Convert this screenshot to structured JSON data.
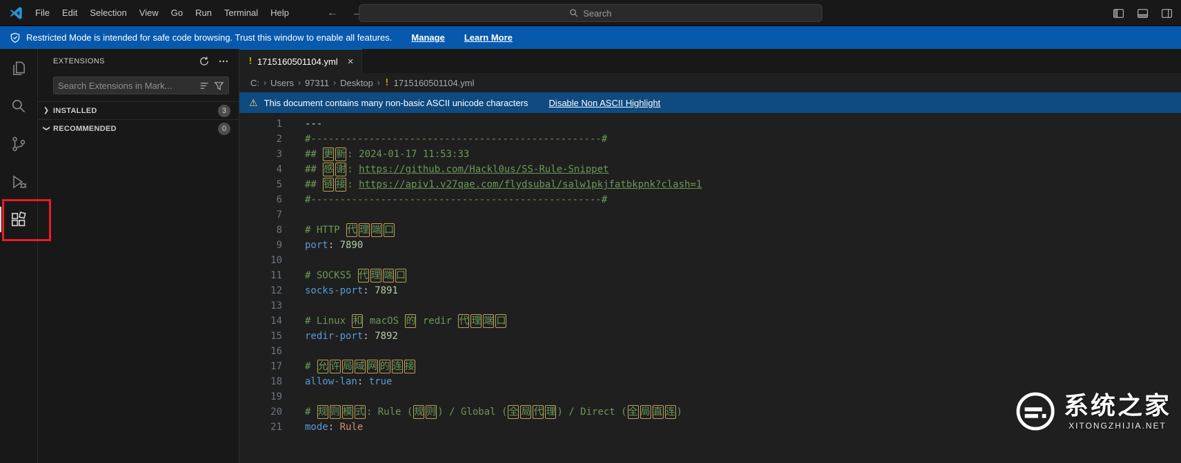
{
  "titlebar": {
    "menus": [
      "File",
      "Edit",
      "Selection",
      "View",
      "Go",
      "Run",
      "Terminal",
      "Help"
    ],
    "search_placeholder": "Search"
  },
  "banner": {
    "message": "Restricted Mode is intended for safe code browsing. Trust this window to enable all features.",
    "manage_label": "Manage",
    "learn_more_label": "Learn More"
  },
  "activity_bar": {
    "items": [
      "explorer",
      "search",
      "source-control",
      "run-and-debug",
      "extensions"
    ],
    "active_item": "extensions"
  },
  "sidebar": {
    "title": "EXTENSIONS",
    "search_placeholder": "Search Extensions in Mark...",
    "sections": [
      {
        "label": "INSTALLED",
        "badge": "3",
        "collapsed": true
      },
      {
        "label": "RECOMMENDED",
        "badge": "0",
        "collapsed": false
      }
    ]
  },
  "editor": {
    "tab": {
      "icon": "!",
      "label": "1715160501104.yml",
      "close": "×"
    },
    "breadcrumb": {
      "path": [
        "C:",
        "Users",
        "97311",
        "Desktop"
      ],
      "file": "1715160501104.yml"
    },
    "notification": {
      "message": "This document contains many non-basic ASCII unicode characters",
      "action": "Disable Non ASCII Highlight"
    },
    "code": {
      "language": "yaml",
      "lines": [
        {
          "num": 1,
          "tokens": [
            {
              "t": "---",
              "c": "plain"
            }
          ]
        },
        {
          "num": 2,
          "tokens": [
            {
              "t": "#--------------------------------------------------#",
              "c": "comment"
            }
          ]
        },
        {
          "num": 3,
          "tokens": [
            {
              "t": "## ",
              "c": "comment"
            },
            {
              "t": "更新",
              "c": "comment",
              "u": true
            },
            {
              "t": ": 2024-01-17 11:53:33",
              "c": "comment"
            }
          ]
        },
        {
          "num": 4,
          "tokens": [
            {
              "t": "## ",
              "c": "comment"
            },
            {
              "t": "感谢",
              "c": "comment",
              "u": true
            },
            {
              "t": ": ",
              "c": "comment"
            },
            {
              "t": "https://github.com/Hackl0us/SS-Rule-Snippet",
              "c": "link"
            }
          ]
        },
        {
          "num": 5,
          "tokens": [
            {
              "t": "## ",
              "c": "comment"
            },
            {
              "t": "链接",
              "c": "comment",
              "u": true
            },
            {
              "t": ": ",
              "c": "comment"
            },
            {
              "t": "https://apiv1.v27qae.com/flydsubal/salw1pkjfatbkpnk?clash=1",
              "c": "link"
            }
          ]
        },
        {
          "num": 6,
          "tokens": [
            {
              "t": "#--------------------------------------------------#",
              "c": "comment"
            }
          ]
        },
        {
          "num": 7,
          "tokens": []
        },
        {
          "num": 8,
          "tokens": [
            {
              "t": "# HTTP ",
              "c": "comment"
            },
            {
              "t": "代理端口",
              "c": "comment",
              "u": true
            }
          ]
        },
        {
          "num": 9,
          "tokens": [
            {
              "t": "port",
              "c": "key"
            },
            {
              "t": ": ",
              "c": "punct"
            },
            {
              "t": "7890",
              "c": "num"
            }
          ]
        },
        {
          "num": 10,
          "tokens": []
        },
        {
          "num": 11,
          "tokens": [
            {
              "t": "# SOCKS5 ",
              "c": "comment"
            },
            {
              "t": "代理端口",
              "c": "comment",
              "u": true
            }
          ]
        },
        {
          "num": 12,
          "tokens": [
            {
              "t": "socks-port",
              "c": "key"
            },
            {
              "t": ": ",
              "c": "punct"
            },
            {
              "t": "7891",
              "c": "num"
            }
          ]
        },
        {
          "num": 13,
          "tokens": []
        },
        {
          "num": 14,
          "tokens": [
            {
              "t": "# Linux ",
              "c": "comment"
            },
            {
              "t": "和",
              "c": "comment",
              "u": true
            },
            {
              "t": " macOS ",
              "c": "comment"
            },
            {
              "t": "的",
              "c": "comment",
              "u": true
            },
            {
              "t": " redir ",
              "c": "comment"
            },
            {
              "t": "代理端口",
              "c": "comment",
              "u": true
            }
          ]
        },
        {
          "num": 15,
          "tokens": [
            {
              "t": "redir-port",
              "c": "key"
            },
            {
              "t": ": ",
              "c": "punct"
            },
            {
              "t": "7892",
              "c": "num"
            }
          ]
        },
        {
          "num": 16,
          "tokens": []
        },
        {
          "num": 17,
          "tokens": [
            {
              "t": "# ",
              "c": "comment"
            },
            {
              "t": "允许局域网的连接",
              "c": "comment",
              "u": true
            }
          ]
        },
        {
          "num": 18,
          "tokens": [
            {
              "t": "allow-lan",
              "c": "key"
            },
            {
              "t": ": ",
              "c": "punct"
            },
            {
              "t": "true",
              "c": "bool"
            }
          ]
        },
        {
          "num": 19,
          "tokens": []
        },
        {
          "num": 20,
          "tokens": [
            {
              "t": "# ",
              "c": "comment"
            },
            {
              "t": "规则模式",
              "c": "comment",
              "u": true
            },
            {
              "t": ": Rule (",
              "c": "comment"
            },
            {
              "t": "规则",
              "c": "comment",
              "u": true
            },
            {
              "t": ") / Global (",
              "c": "comment"
            },
            {
              "t": "全局代理",
              "c": "comment",
              "u": true
            },
            {
              "t": ") / Direct (",
              "c": "comment"
            },
            {
              "t": "全局直连",
              "c": "comment",
              "u": true
            },
            {
              "t": ")",
              "c": "comment"
            }
          ]
        },
        {
          "num": 21,
          "tokens": [
            {
              "t": "mode",
              "c": "key"
            },
            {
              "t": ": ",
              "c": "punct"
            },
            {
              "t": "Rule",
              "c": "str"
            }
          ]
        }
      ]
    }
  },
  "watermark": {
    "title": "系统之家",
    "domain": "XITONGZHIJIA.NET"
  },
  "colors": {
    "banner_blue": "#0759ae",
    "notification_blue": "#0f4a81",
    "comment_green": "#6a9955",
    "key_blue": "#569cd6",
    "number_green": "#b5cea8",
    "string_orange": "#ce9178",
    "warning_yellow": "#ddb100",
    "annotation_red": "#ec1c24",
    "unicode_box_yellow": "#ddbb64"
  }
}
